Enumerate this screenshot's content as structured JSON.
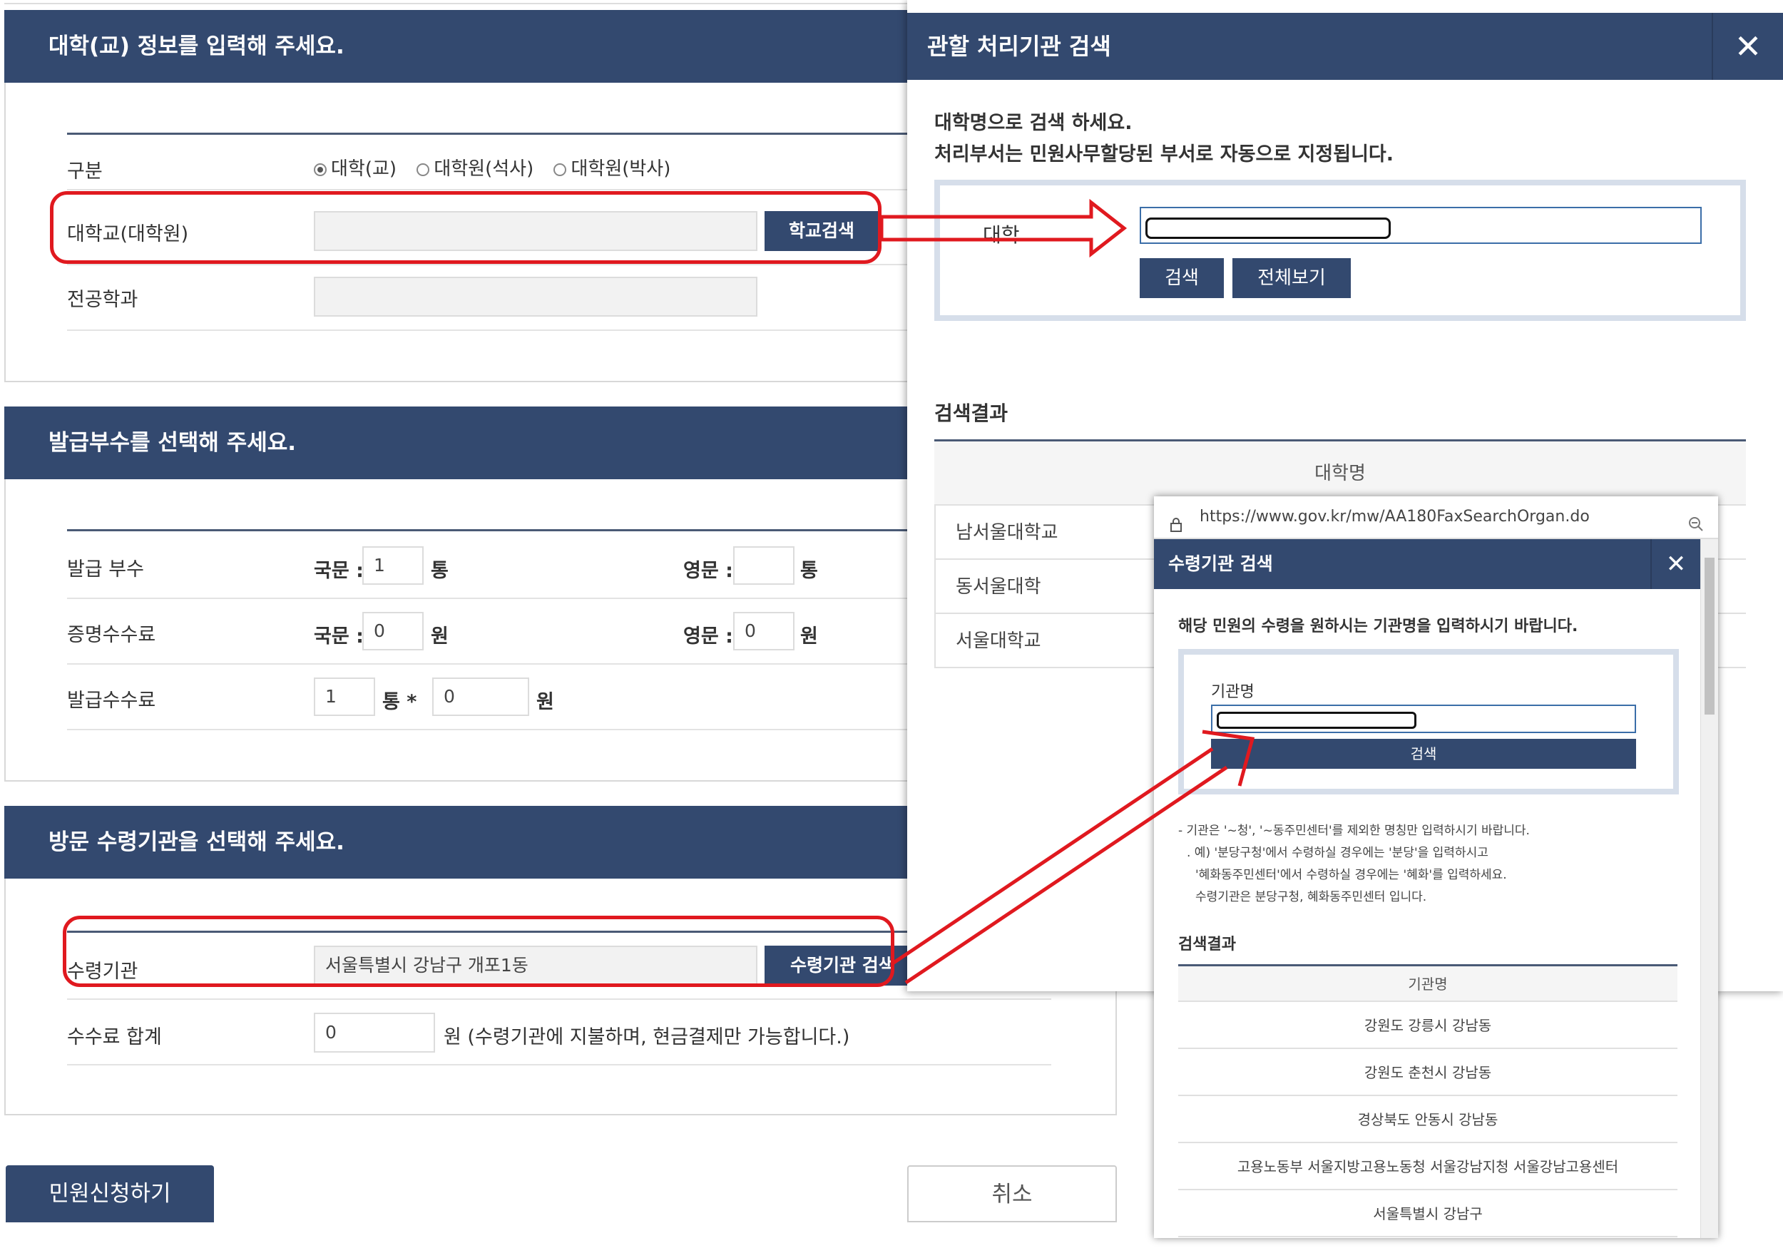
{
  "form": {
    "univ_section": {
      "title": "대학(교) 정보를 입력해 주세요.",
      "type_label": "구분",
      "type_options": [
        "대학(교)",
        "대학원(석사)",
        "대학원(박사)"
      ],
      "school_label": "대학교(대학원)",
      "school_search_button": "학교검색",
      "major_label": "전공학과"
    },
    "copies_section": {
      "title": "발급부수를 선택해 주세요.",
      "copies_label": "발급 부수",
      "korean_label": "국문 :",
      "korean_copies": "1",
      "copies_unit": "통",
      "english_label": "영문 :",
      "english_copies": "",
      "cert_fee_label": "증명수수료",
      "korean_fee": "0",
      "won_unit": "원",
      "english_fee": "0",
      "issue_fee_label": "발급수수료",
      "issue_count": "1",
      "multiply": "통 *",
      "issue_fee": "0"
    },
    "pickup_section": {
      "title": "방문 수령기관을 선택해 주세요.",
      "agency_label": "수령기관",
      "agency_value": "서울특별시 강남구 개포1동",
      "agency_search_button": "수령기관 검색",
      "total_fee_label": "수수료 합계",
      "total_fee_value": "0",
      "total_fee_note": "원 (수령기관에 지불하며, 현금결제만 가능합니다.)"
    },
    "submit_button": "민원신청하기",
    "cancel_button": "취소"
  },
  "modal_office": {
    "title": "관할 처리기관 검색",
    "close": "✕",
    "desc_line1": "대학명으로 검색 하세요.",
    "desc_line2": "처리부서는 민원사무할당된 부서로 자동으로 지정됩니다.",
    "univ_label": "대학",
    "search_button": "검색",
    "view_all_button": "전체보기",
    "results_title": "검색결과",
    "column_header": "대학명",
    "results": [
      "남서울대학교",
      "동서울대학",
      "서울대학교"
    ]
  },
  "modal_agency": {
    "url": "https://www.gov.kr/mw/AA180FaxSearchOrgan.do",
    "title": "수령기관 검색",
    "close": "✕",
    "instruction": "해당 민원의 수령을 원하시는 기관명을 입력하시기 바랍니다.",
    "name_label": "기관명",
    "search_button": "검색",
    "note_line1": "- 기관은 '~청', '~동주민센터'를 제외한 명칭만 입력하시기 바랍니다.",
    "note_line2": ". 예) '분당구청'에서 수령하실 경우에는 '분당'을 입력하시고",
    "note_line3": "'혜화동주민센터'에서 수령하실 경우에는 '혜화'를 입력하세요.",
    "note_line4": "수령기관은 분당구청, 혜화동주민센터 입니다.",
    "results_title": "검색결과",
    "column_header": "기관명",
    "results": [
      "강원도 강릉시 강남동",
      "강원도 춘천시 강남동",
      "경상북도 안동시 강남동",
      "고용노동부 서울지방고용노동청 서울강남지청 서울강남고용센터",
      "서울특별시 강남구"
    ]
  },
  "colors": {
    "header_navy": "#33496f",
    "annotation_red": "#e0191f"
  }
}
